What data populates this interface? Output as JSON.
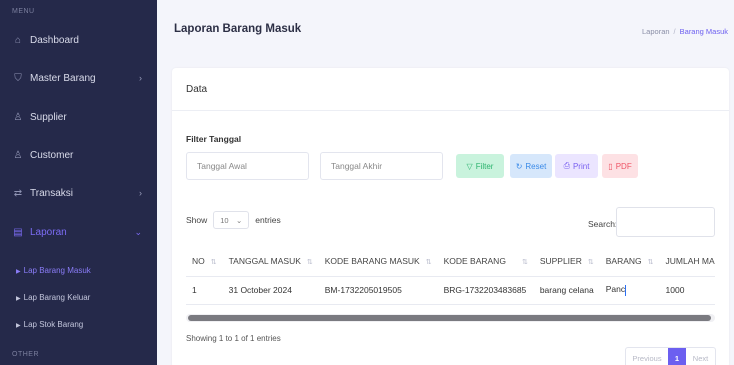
{
  "sidebar": {
    "menu_heading": "MENU",
    "other_heading": "OTHER",
    "items": [
      {
        "label": "Dashboard",
        "icon": "home-icon"
      },
      {
        "label": "Master Barang",
        "icon": "shield-icon",
        "chevron": "›"
      },
      {
        "label": "Supplier",
        "icon": "user-icon"
      },
      {
        "label": "Customer",
        "icon": "user-icon"
      },
      {
        "label": "Transaksi",
        "icon": "exchange-icon",
        "chevron": "›"
      },
      {
        "label": "Laporan",
        "icon": "file-icon",
        "chevron": "⌄"
      }
    ],
    "subitems": [
      {
        "label": "Lap Barang Masuk"
      },
      {
        "label": "Lap Barang Keluar"
      },
      {
        "label": "Lap Stok Barang"
      }
    ]
  },
  "header": {
    "title": "Laporan Barang Masuk",
    "breadcrumb": [
      "Laporan",
      "Barang Masuk"
    ],
    "breadcrumb_sep": "/"
  },
  "card": {
    "title": "Data",
    "filter_label": "Filter Tanggal",
    "start_placeholder": "Tanggal Awal",
    "end_placeholder": "Tanggal Akhir",
    "buttons": {
      "filter": "Filter",
      "reset": "Reset",
      "print": "Print",
      "pdf": "PDF"
    },
    "show_label": "Show",
    "entries_value": "10",
    "entries_label": "entries",
    "search_label": "Search:"
  },
  "table": {
    "columns": [
      "NO",
      "TANGGAL MASUK",
      "KODE BARANG MASUK",
      "KODE BARANG",
      "SUPPLIER",
      "BARANG",
      "JUMLAH MASUK"
    ],
    "sort_glyph": "⇅",
    "rows": [
      [
        "1",
        "31 October 2024",
        "BM-1732205019505",
        "BRG-1732203483685",
        "barang celana",
        "Panc",
        "1000"
      ]
    ]
  },
  "footer": {
    "showing": "Showing 1 to 1 of 1 entries",
    "prev": "Previous",
    "page": "1",
    "next": "Next"
  },
  "colors": {
    "sidebar_bg": "#25294a",
    "accent": "#6c5ff0"
  }
}
